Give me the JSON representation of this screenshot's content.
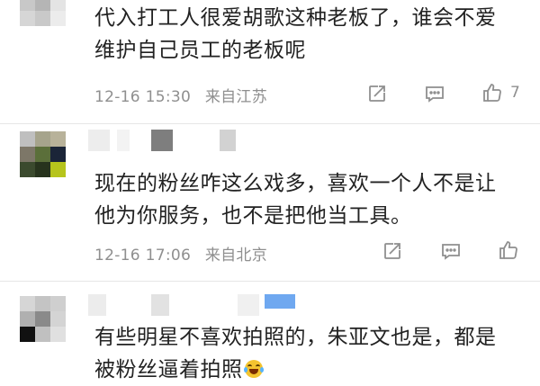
{
  "comments": [
    {
      "text_line1": "代入打工人很爱胡歌这种老板了，谁会不爱",
      "text_line2": "维护自己员工的老板呢",
      "time": "12-16 15:30",
      "location": "来自江苏",
      "likes": "7"
    },
    {
      "text_line1": "现在的粉丝咋这么戏多，喜欢一个人不是让",
      "text_line2": "他为你服务，也不是把他当工具。",
      "time": "12-16 17:06",
      "location": "来自北京",
      "likes": ""
    },
    {
      "text_line1": "有些明星不喜欢拍照的，朱亚文也是，都是",
      "text_line2": "被粉丝逼着拍照",
      "emoji": "laughing-crying-emoji"
    }
  ],
  "icons": {
    "share": "share-icon",
    "reply": "reply-icon",
    "like": "thumbs-up-icon"
  },
  "colors": {
    "text": "#222222",
    "meta": "#8f8f8f",
    "divider": "#e6e6e6",
    "name_highlight": "#6fa8f0"
  }
}
